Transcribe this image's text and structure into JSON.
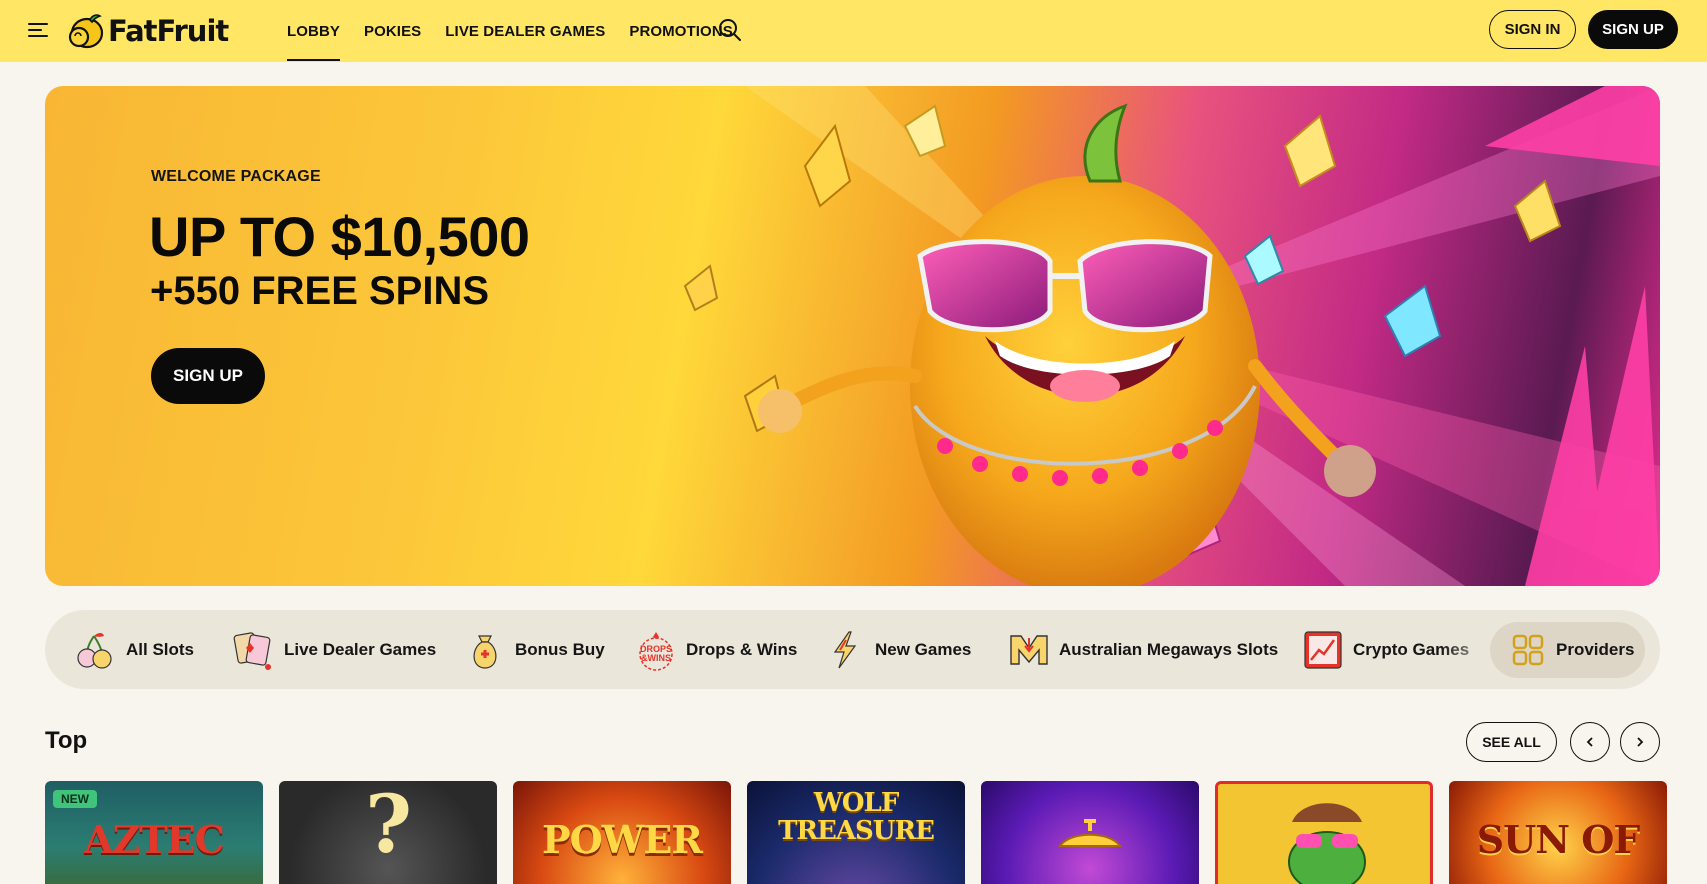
{
  "header": {
    "logo_text": "FatFruit",
    "nav": [
      {
        "label": "LOBBY",
        "active": true
      },
      {
        "label": "POKIES",
        "active": false
      },
      {
        "label": "LIVE DEALER GAMES",
        "active": false
      },
      {
        "label": "PROMOTIONS",
        "active": false
      }
    ],
    "sign_in": "SIGN IN",
    "sign_up": "SIGN UP"
  },
  "hero": {
    "kicker": "WELCOME PACKAGE",
    "title": "UP TO $10,500",
    "subtitle": "+550 FREE SPINS",
    "cta": "SIGN UP"
  },
  "categories": [
    {
      "label": "All Slots",
      "icon": "cherries-icon"
    },
    {
      "label": "Live Dealer Games",
      "icon": "playing-cards-icon"
    },
    {
      "label": "Bonus Buy",
      "icon": "money-bag-icon"
    },
    {
      "label": "Drops & Wins",
      "icon": "drops-wins-icon"
    },
    {
      "label": "New Games",
      "icon": "lightning-icon"
    },
    {
      "label": "Australian Megaways Slots",
      "icon": "megaways-icon"
    },
    {
      "label": "Crypto Games",
      "icon": "crypto-chart-icon"
    },
    {
      "label": "Providers",
      "icon": "grid-icon"
    }
  ],
  "top_section": {
    "title": "Top",
    "see_all": "SEE ALL",
    "tiles": [
      {
        "label": "AZTEC",
        "badge": "NEW"
      },
      {
        "label": "?",
        "badge": ""
      },
      {
        "label": "POWER",
        "badge": ""
      },
      {
        "label": "WOLF TREASURE",
        "badge": ""
      },
      {
        "label": "",
        "badge": ""
      },
      {
        "label": "",
        "badge": ""
      },
      {
        "label": "SUN OF",
        "badge": ""
      }
    ]
  },
  "colors": {
    "header_bg": "#ffe664",
    "page_bg": "#f8f5ee",
    "primary": "#0a0a0a",
    "category_bar": "#ebe6da",
    "new_badge": "#3fc47a"
  }
}
